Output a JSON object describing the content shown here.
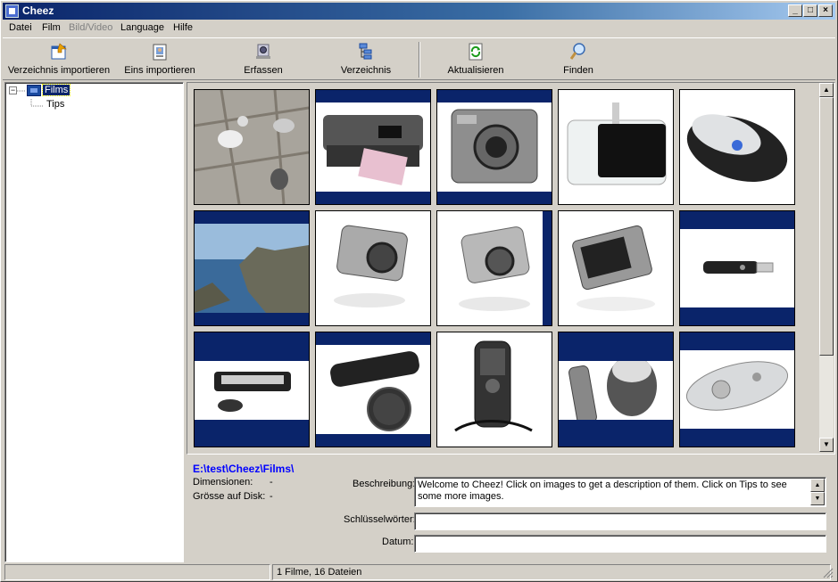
{
  "window": {
    "title": "Cheez"
  },
  "menu": [
    "Datei",
    "Film",
    "Bild/Video",
    "Language",
    "Hilfe"
  ],
  "menu_disabled": [
    false,
    false,
    true,
    false,
    false
  ],
  "toolbar": [
    {
      "label": "Verzeichnis importieren",
      "icon": "folder-import-icon"
    },
    {
      "label": "Eins importieren",
      "icon": "file-import-icon"
    },
    {
      "label": "Erfassen",
      "icon": "camera-capture-icon"
    },
    {
      "label": "Verzeichnis",
      "icon": "directory-tree-icon"
    },
    {
      "label": "Aktualisieren",
      "icon": "refresh-icon"
    },
    {
      "label": "Finden",
      "icon": "search-icon"
    }
  ],
  "tree": {
    "root": "Films",
    "child": "Tips",
    "expander": "−"
  },
  "thumbnails": [
    "cats",
    "printer",
    "camera",
    "ipod-dock",
    "mouse",
    "coast",
    "camera-silver",
    "camera-silver-2",
    "camera-lcd",
    "usb-stick",
    "scanner-mouse",
    "usb-case",
    "phone",
    "usb-mouse",
    "remote"
  ],
  "info": {
    "path": "E:\\test\\Cheez\\Films\\",
    "dimensions_label": "Dimensionen:",
    "dimensions_value": "-",
    "size_label": "Grösse auf Disk:",
    "size_value": "-",
    "description_label": "Beschreibung:",
    "description": "Welcome to Cheez! Click on images to get a description of them. Click on Tips to see some more images.",
    "keywords_label": "Schlüsselwörter:",
    "keywords": "",
    "date_label": "Datum:",
    "date": ""
  },
  "status": {
    "left": "",
    "right": "1 Filme, 16 Dateien"
  },
  "colors": {
    "title_start": "#0a246a",
    "selection": "#0a246a",
    "path_link": "#0000ff"
  }
}
